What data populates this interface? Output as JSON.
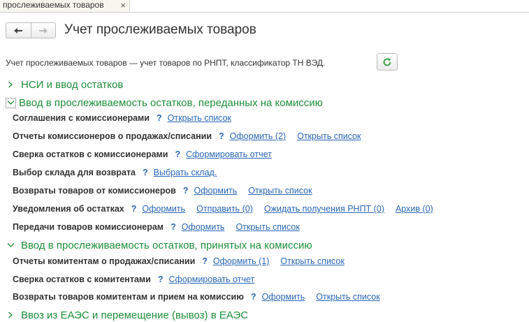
{
  "tab": {
    "label": "прослеживаемых товаров",
    "close": "×"
  },
  "header": {
    "title": "Учет прослеживаемых товаров"
  },
  "description": "Учет прослеживаемых товаров — учет товаров по РНПТ, классификатор ТН ВЭД.",
  "colors": {
    "accent_green": "#1e8f3b",
    "link_blue": "#2a67b6"
  },
  "groups": [
    {
      "label": "НСИ и ввод остатков",
      "state": "collapsed"
    },
    {
      "label": "Ввод в прослеживаемость остатков, переданных на комиссию",
      "state": "expanded",
      "rows": [
        {
          "name": "Соглашения с комиссионерами",
          "links": [
            "Открыть список"
          ]
        },
        {
          "name": "Отчеты комиссионеров о продажах/списании",
          "links": [
            "Оформить (2)",
            "Открыть список"
          ]
        },
        {
          "name": "Сверка остатков с комиссионерами",
          "links": [
            "Сформировать отчет"
          ]
        },
        {
          "name": "Выбор склада для возврата",
          "links": [
            "Выбрать склад."
          ]
        },
        {
          "name": "Возвраты товаров от комиссионеров",
          "links": [
            "Оформить",
            "Открыть список"
          ]
        },
        {
          "name": "Уведомления об остатках",
          "links": [
            "Оформить",
            "Отправить (0)",
            "Ожидать получения РНПТ (0)",
            "Архив (0)"
          ]
        },
        {
          "name": "Передачи товаров комиссионерам",
          "links": [
            "Оформить",
            "Открыть список"
          ]
        }
      ]
    },
    {
      "label": "Ввод в прослеживаемость остатков, принятых на комиссию",
      "state": "expanded",
      "rows": [
        {
          "name": "Отчеты комитентам о продажах/списании",
          "links": [
            "Оформить (1)",
            "Открыть список"
          ]
        },
        {
          "name": "Сверка остатков с комитентами",
          "links": [
            "Сформировать отчет"
          ]
        },
        {
          "name": "Возвраты товаров комитентам и прием на комиссию",
          "links": [
            "Оформить",
            "Открыть список"
          ]
        }
      ]
    },
    {
      "label": "Ввоз из ЕАЭС и перемещение (вывоз) в ЕАЭС",
      "state": "collapsed"
    }
  ],
  "help_mark": "?"
}
